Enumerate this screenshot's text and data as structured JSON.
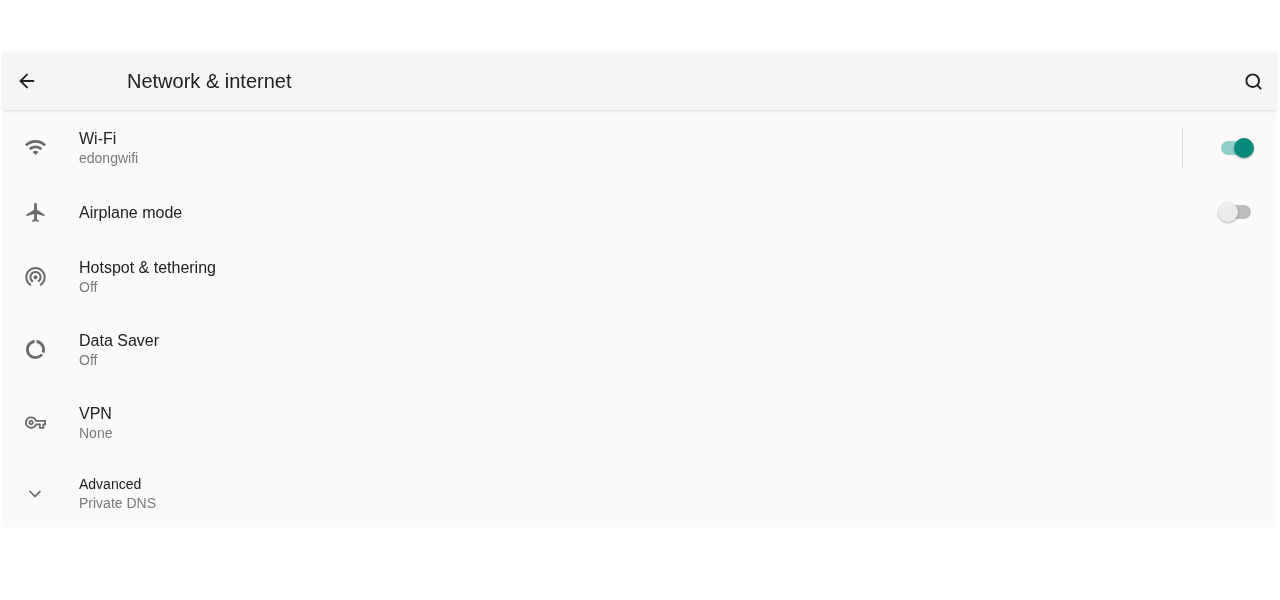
{
  "toolbar": {
    "title": "Network & internet"
  },
  "items": [
    {
      "kind": "master_switch",
      "title": "Wi-Fi",
      "summary": "edongwifi",
      "on": true
    },
    {
      "kind": "switch",
      "title": "Airplane mode",
      "on": false
    },
    {
      "kind": "link",
      "title": "Hotspot & tethering",
      "summary": "Off"
    },
    {
      "kind": "link",
      "title": "Data Saver",
      "summary": "Off"
    },
    {
      "kind": "link",
      "title": "VPN",
      "summary": "None"
    },
    {
      "kind": "expand",
      "title": "Advanced",
      "summary": "Private DNS"
    }
  ]
}
